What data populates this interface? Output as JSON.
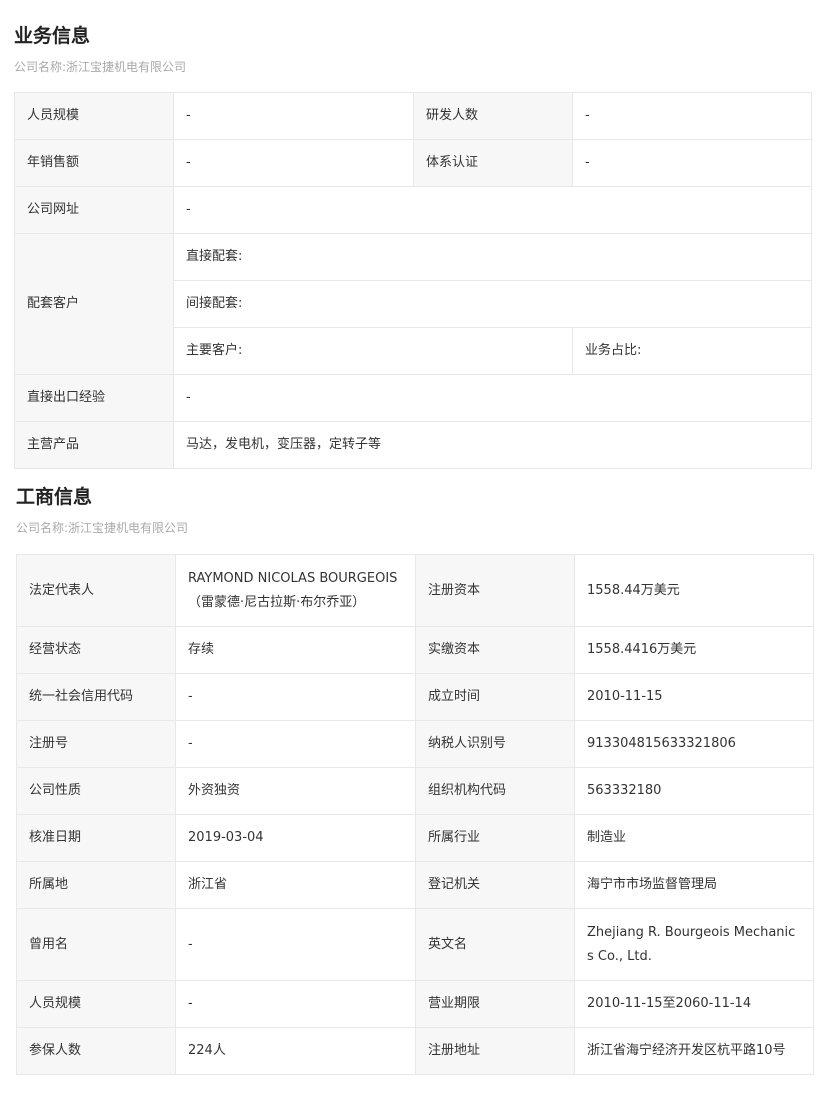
{
  "business": {
    "title": "业务信息",
    "company_label": "公司名称:浙江宝捷机电有限公司",
    "staff_size": {
      "label": "人员规模",
      "value": "-"
    },
    "rd_staff": {
      "label": "研发人数",
      "value": "-"
    },
    "annual_sales": {
      "label": "年销售额",
      "value": "-"
    },
    "certification": {
      "label": "体系认证",
      "value": "-"
    },
    "website": {
      "label": "公司网址",
      "value": "-"
    },
    "customers": {
      "label": "配套客户",
      "direct": "直接配套:",
      "indirect": "间接配套:",
      "main_customer": "主要客户:",
      "business_share": "业务占比:"
    },
    "export_experience": {
      "label": "直接出口经验",
      "value": "-"
    },
    "main_products": {
      "label": "主营产品",
      "value": "马达，发电机，变压器，定转子等"
    }
  },
  "registration": {
    "title": "工商信息",
    "company_label": "公司名称:浙江宝捷机电有限公司",
    "rows": [
      {
        "l1": "法定代表人",
        "v1": "RAYMOND NICOLAS BOURGEOIS（雷蒙德·尼古拉斯·布尔乔亚）",
        "l2": "注册资本",
        "v2": "1558.44万美元"
      },
      {
        "l1": "经营状态",
        "v1": "存续",
        "l2": "实缴资本",
        "v2": "1558.4416万美元"
      },
      {
        "l1": "统一社会信用代码",
        "v1": "-",
        "l2": "成立时间",
        "v2": "2010-11-15"
      },
      {
        "l1": "注册号",
        "v1": "-",
        "l2": "纳税人识别号",
        "v2": "913304815633321806"
      },
      {
        "l1": "公司性质",
        "v1": "外资独资",
        "l2": "组织机构代码",
        "v2": "563332180"
      },
      {
        "l1": "核准日期",
        "v1": "2019-03-04",
        "l2": "所属行业",
        "v2": "制造业"
      },
      {
        "l1": "所属地",
        "v1": "浙江省",
        "l2": "登记机关",
        "v2": "海宁市市场监督管理局"
      },
      {
        "l1": "曾用名",
        "v1": "-",
        "l2": "英文名",
        "v2": "Zhejiang R. Bourgeois Mechanics Co., Ltd."
      },
      {
        "l1": "人员规模",
        "v1": "-",
        "l2": "营业期限",
        "v2": "2010-11-15至2060-11-14"
      },
      {
        "l1": "参保人数",
        "v1": "224人",
        "l2": "注册地址",
        "v2": "浙江省海宁经济开发区杭平路10号"
      }
    ]
  }
}
